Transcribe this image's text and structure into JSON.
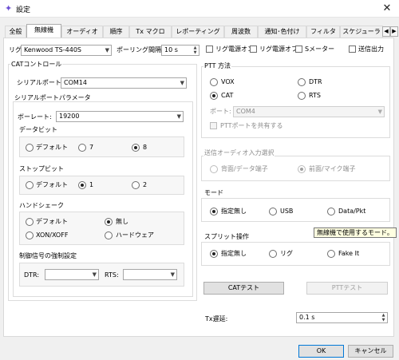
{
  "window": {
    "title": "設定"
  },
  "tabs": [
    "全般",
    "無線機",
    "オーディオ",
    "順序",
    "Tx マクロ",
    "レポーティング",
    "周波数",
    "通知･色付け",
    "フィルタ",
    "スケジューラ"
  ],
  "top": {
    "rig_label": "リグ:",
    "rig_value": "Kenwood TS-440S",
    "poll_label": "ポーリング間隔:",
    "poll_value": "10 s",
    "rig_power_on": "リグ電源オン",
    "rig_power_off": "リグ電源オフ",
    "s_meter": "Sメーター",
    "tx_power": "送信出力"
  },
  "cat": {
    "title": "CATコントロール",
    "serial_port_label": "シリアルポート:",
    "serial_port_value": "COM14",
    "serial_params_title": "シリアルポートパラメータ",
    "baud_label": "ボーレート:",
    "baud_value": "19200",
    "data_bits_title": "データビット",
    "data_bits_options": [
      "デフォルト",
      "7",
      "8"
    ],
    "stop_bits_title": "ストップビット",
    "stop_bits_options": [
      "デフォルト",
      "1",
      "2"
    ],
    "handshake_title": "ハンドシェーク",
    "handshake_options": [
      "デフォルト",
      "無し",
      "XON/XOFF",
      "ハードウェア"
    ],
    "force_title": "制御信号の強制設定",
    "dtr_label": "DTR:",
    "rts_label": "RTS:"
  },
  "ptt": {
    "title": "PTT 方法",
    "options": [
      "VOX",
      "DTR",
      "CAT",
      "RTS"
    ],
    "port_label": "ポート:",
    "port_value": "COM4",
    "share_label": "PTTポートを共有する"
  },
  "audio": {
    "title": "送信オーディオ入力選択",
    "options": [
      "背面/データ端子",
      "前面/マイク端子"
    ]
  },
  "mode": {
    "title": "モード",
    "options": [
      "指定無し",
      "USB",
      "Data/Pkt"
    ],
    "tooltip": "無線機で使用するモード。"
  },
  "split": {
    "title": "スプリット操作",
    "options": [
      "指定無し",
      "リグ",
      "Fake It"
    ]
  },
  "buttons": {
    "cat_test": "CATテスト",
    "ptt_test": "PTTテスト",
    "ok": "OK",
    "cancel": "キャンセル"
  },
  "tx_delay": {
    "label": "Tx遅延:",
    "value": "0.1 s"
  },
  "colors": {
    "accent": "#0078d7",
    "icon": "#6c4fd4"
  }
}
